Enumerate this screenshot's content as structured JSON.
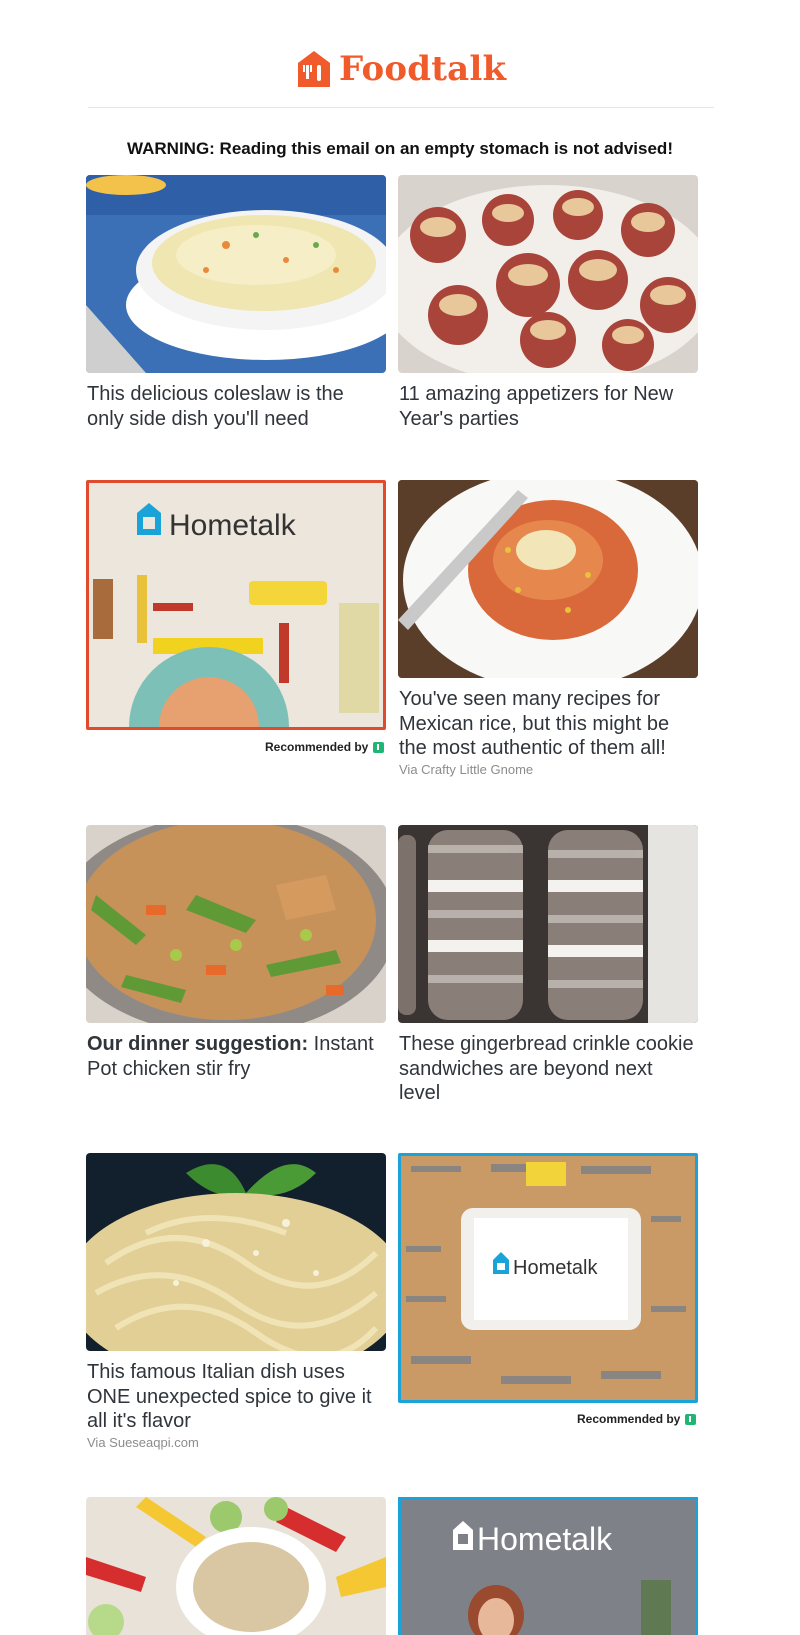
{
  "header": {
    "brand": "Foodtalk",
    "warning": "WARNING: Reading this email on an empty stomach is not advised!"
  },
  "cards": [
    {
      "title": "This delicious coleslaw is the only side dish you'll need"
    },
    {
      "title": "11 amazing appetizers for New Year's parties"
    },
    {
      "ad_brand": "Hometalk",
      "recommended": "Recommended by"
    },
    {
      "title": "You've seen many recipes for Mexican rice, but this might be the most authentic of them all!",
      "via": "Via Crafty Little Gnome"
    },
    {
      "title_bold": "Our dinner suggestion:",
      "title_rest": " Instant Pot chicken stir fry"
    },
    {
      "title": "These gingerbread crinkle cookie sandwiches are beyond next level"
    },
    {
      "title": "This famous Italian dish uses ONE unexpected spice to give it all it's flavor",
      "via": "Via Sueseaqpi.com"
    },
    {
      "ad_brand": "Hometalk",
      "recommended": "Recommended by"
    },
    {},
    {
      "ad_brand": "Hometalk"
    }
  ],
  "colors": {
    "brand_orange": "#f15a2b",
    "hometalk_blue": "#1aa3d9",
    "ad_red_border": "#e04b2e"
  }
}
